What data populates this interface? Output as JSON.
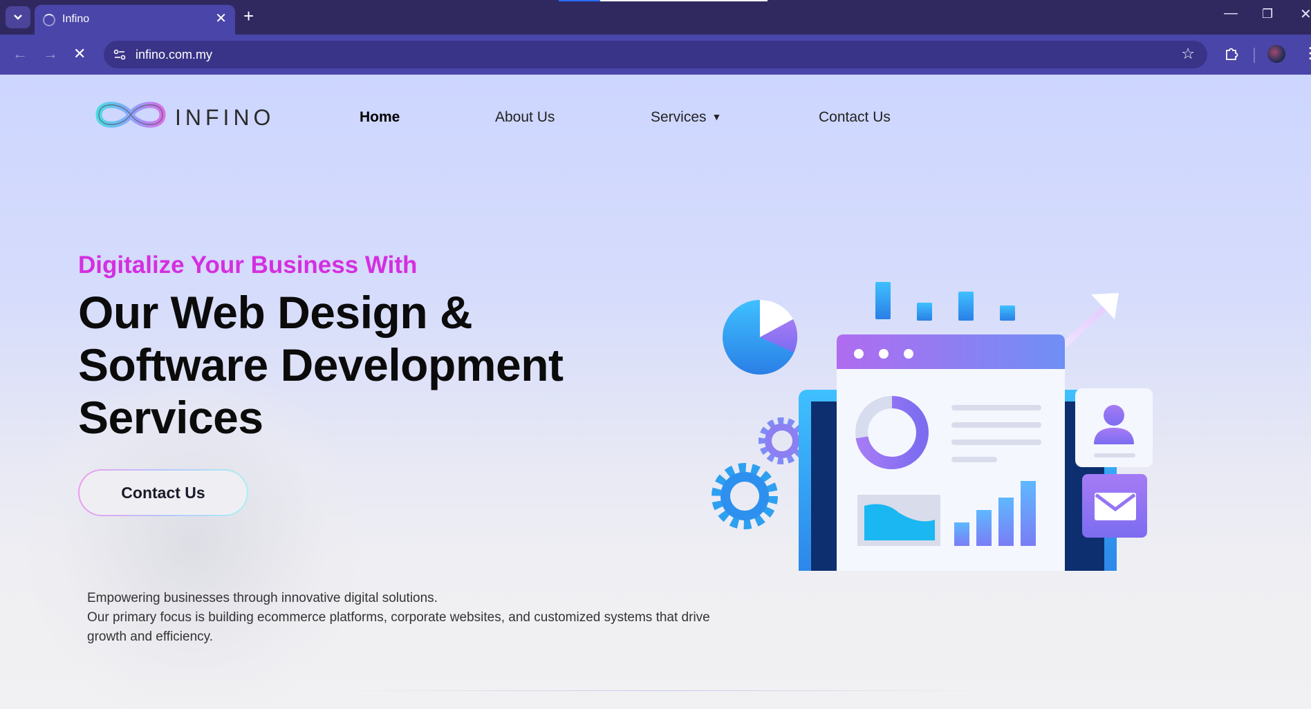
{
  "browser": {
    "tab_title": "Infino",
    "url": "infino.com.my",
    "icons": [
      "tab-search-icon",
      "close-icon",
      "plus-icon",
      "minimize-icon",
      "restore-icon",
      "window-close-icon",
      "back-icon",
      "forward-icon",
      "stop-icon",
      "site-info-icon",
      "star-icon",
      "extensions-icon",
      "more-icon"
    ]
  },
  "brand": {
    "name": "INFINO"
  },
  "nav": {
    "home": "Home",
    "about": "About Us",
    "services": "Services",
    "contact": "Contact Us"
  },
  "hero": {
    "kicker": "Digitalize Your Business With",
    "headline": [
      "Our Web Design &",
      "Software Development",
      "Services"
    ],
    "cta_label": "Contact Us",
    "description": [
      "Empowering businesses through innovative digital solutions.",
      "Our primary focus is building ecommerce platforms, corporate websites, and customized systems that drive",
      "growth and efficiency."
    ]
  },
  "colors": {
    "chrome_dark": "#2f2960",
    "chrome": "#4a45a8",
    "kicker": "#d42fe0",
    "accent_blue": "#2e9bf0",
    "accent_purple": "#a57bf5"
  }
}
